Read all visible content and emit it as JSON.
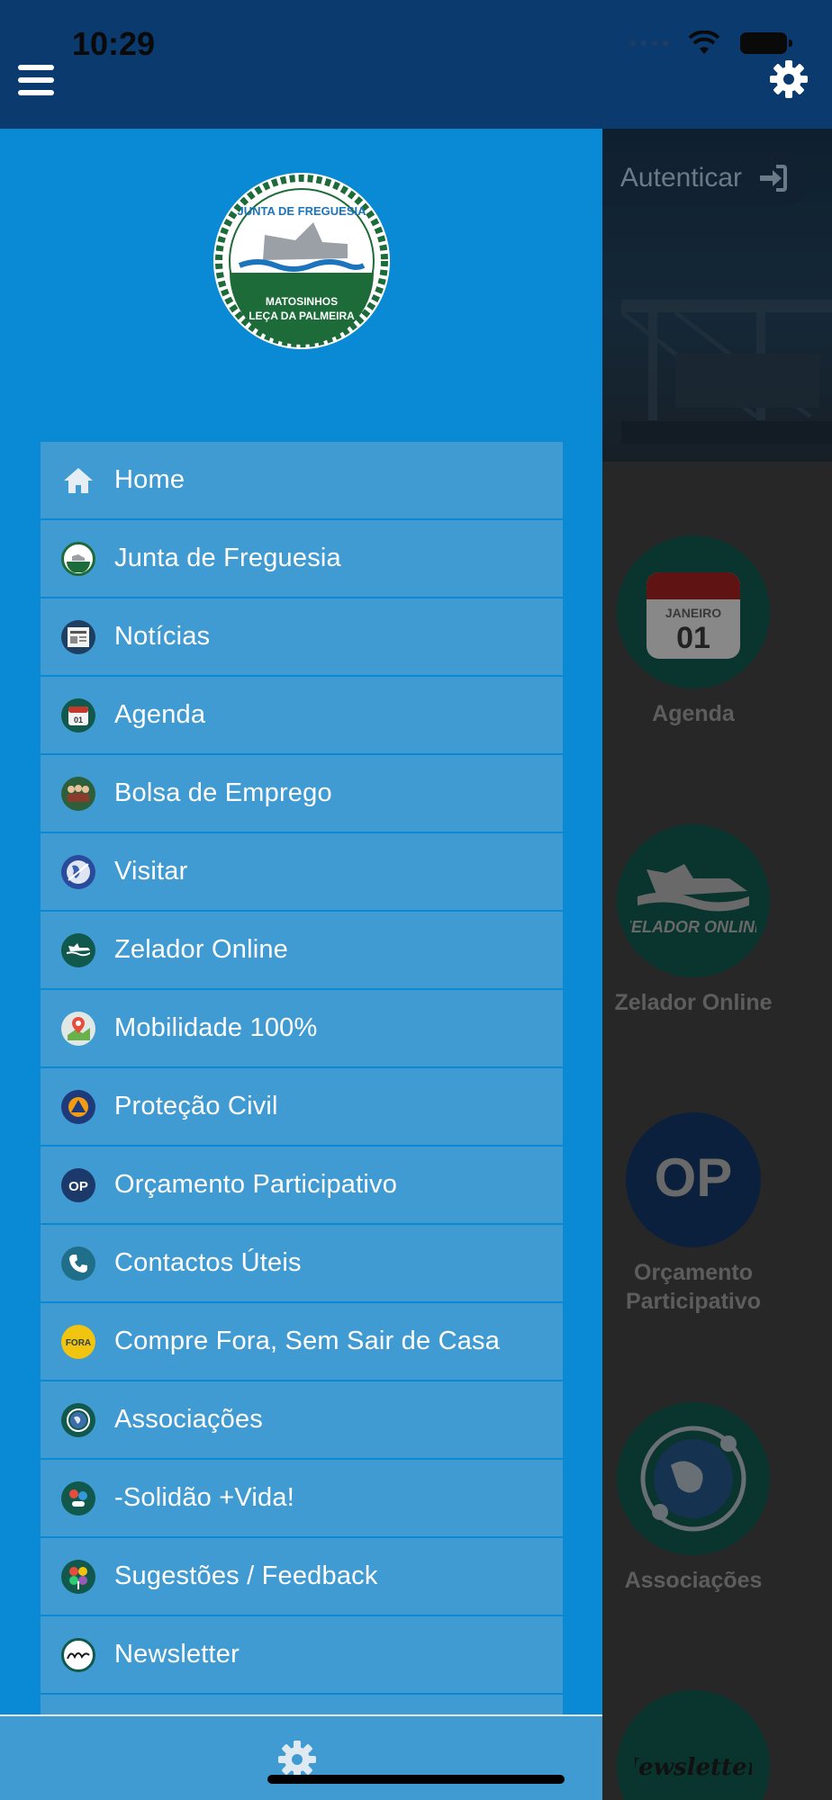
{
  "status_bar": {
    "time": "10:29"
  },
  "top_bar": {
    "menu_icon": "hamburger-icon",
    "settings_icon": "gear-icon",
    "background_color": "#0b3a6e"
  },
  "background_page": {
    "auth_button_label": "Autenticar",
    "tiles": [
      {
        "label": "Agenda",
        "calendar_month": "JANEIRO",
        "calendar_day": "01"
      },
      {
        "label": "Zelador Online",
        "badge_text": "ZELADOR ONLINE"
      },
      {
        "label": "Orçamento Participativo",
        "badge_text": "OP"
      },
      {
        "label": "Associações"
      },
      {
        "label": "",
        "badge_text": "Newsletter!"
      }
    ]
  },
  "drawer": {
    "background_color": "#0a89d4",
    "item_color": "#419bd3",
    "logo": {
      "top_text": "JUNTA DE FREGUESIA",
      "line1": "MATOSINHOS",
      "line2": "LEÇA DA PALMEIRA"
    },
    "menu_items": [
      {
        "label": "Home",
        "icon": "home-icon"
      },
      {
        "label": "Junta de Freguesia",
        "icon": "junta-logo-icon"
      },
      {
        "label": "Notícias",
        "icon": "newspaper-icon"
      },
      {
        "label": "Agenda",
        "icon": "calendar-icon"
      },
      {
        "label": "Bolsa de Emprego",
        "icon": "jobs-icon"
      },
      {
        "label": "Visitar",
        "icon": "globe-icon"
      },
      {
        "label": "Zelador Online",
        "icon": "zelador-icon"
      },
      {
        "label": "Mobilidade 100%",
        "icon": "map-pin-icon"
      },
      {
        "label": "Proteção Civil",
        "icon": "civil-protection-icon"
      },
      {
        "label": "Orçamento Participativo",
        "icon": "op-icon"
      },
      {
        "label": "Contactos Úteis",
        "icon": "phone-icon"
      },
      {
        "label": "Compre Fora, Sem Sair de Casa",
        "icon": "shop-badge-icon"
      },
      {
        "label": "Associações",
        "icon": "associations-icon"
      },
      {
        "label": "-Solidão +Vida!",
        "icon": "solidarity-icon"
      },
      {
        "label": "Sugestões / Feedback",
        "icon": "feedback-icon"
      },
      {
        "label": "Newsletter",
        "icon": "newsletter-icon"
      }
    ],
    "footer_icon": "gear-icon"
  }
}
